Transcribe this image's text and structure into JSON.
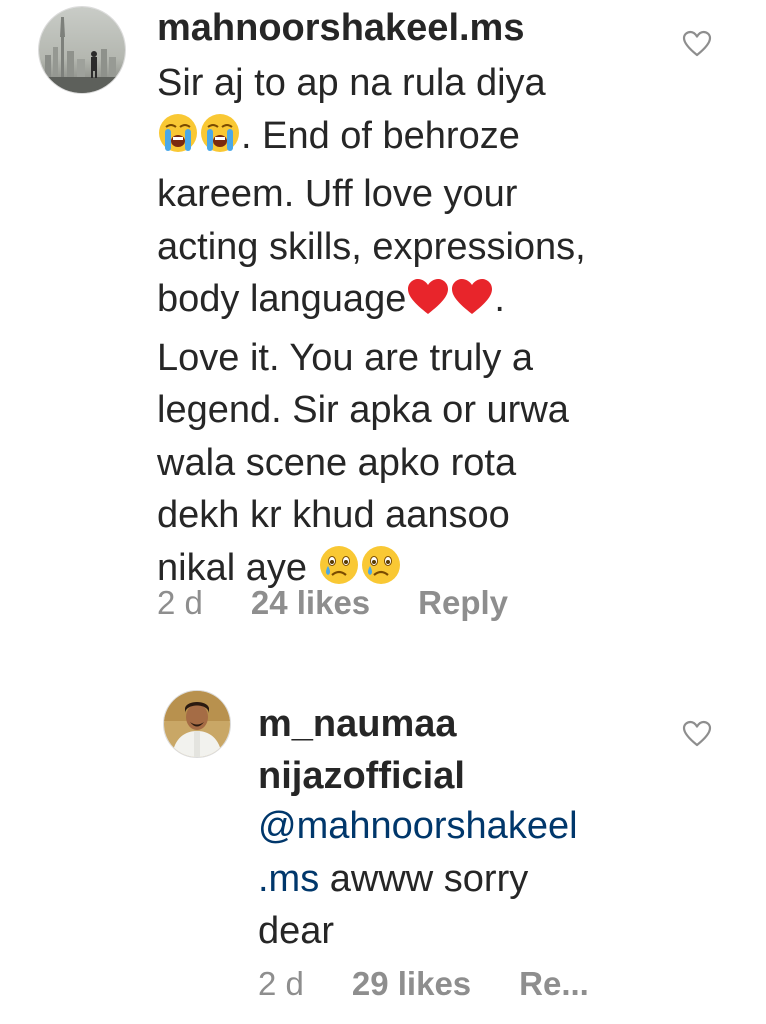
{
  "comments": [
    {
      "username": "mahnoorshakeel.ms",
      "lines": [
        {
          "t": "Sir aj to ap na rula diya"
        },
        {
          "pre_emoji": [
            "loudly-crying-face",
            "loudly-crying-face"
          ],
          "t": ". End of behroze"
        },
        {
          "t": "kareem. Uff love your"
        },
        {
          "t": "acting skills, expressions,"
        },
        {
          "t": "body language",
          "post_emoji": [
            "red-heart",
            "red-heart"
          ],
          "t2": "."
        },
        {
          "t": "Love it. You are truly a"
        },
        {
          "t": "legend. Sir apka or urwa"
        },
        {
          "t": "wala scene apko rota"
        },
        {
          "t": "dekh kr khud aansoo"
        },
        {
          "t": "nikal aye ",
          "post_emoji": [
            "crying-face",
            "crying-face"
          ]
        }
      ],
      "age": "2 d",
      "likes": "24 likes",
      "reply": "Reply",
      "icons": {
        "like": "heart-outline-icon"
      }
    },
    {
      "username": "m_naumaa nijazofficial",
      "username_lines": [
        "m_naumaa",
        "nijazofficial"
      ],
      "mention_line1": "@mahnoorshakeel",
      "mention_line2": ".ms",
      "text_after_mention": " awww sorry",
      "text_line3": "dear",
      "age": "2 d",
      "likes": "29 likes",
      "reply": "Re...",
      "icons": {
        "like": "heart-outline-icon"
      }
    }
  ],
  "colors": {
    "text": "#262626",
    "meta": "#8e8e8e",
    "mention": "#00376b",
    "heart_stroke": "#8e8e8e"
  }
}
